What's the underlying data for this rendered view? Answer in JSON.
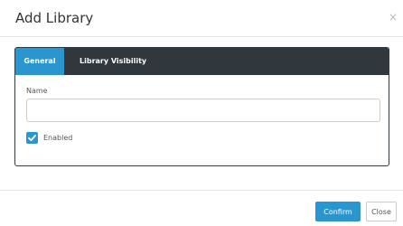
{
  "dialog": {
    "title": "Add Library",
    "close_glyph": "×"
  },
  "tabs": [
    {
      "label": "General",
      "active": true
    },
    {
      "label": "Library Visibility",
      "active": false
    }
  ],
  "form": {
    "name_label": "Name",
    "name_value": "",
    "name_placeholder": "",
    "enabled_label": "Enabled",
    "enabled_checked": true
  },
  "footer": {
    "confirm_label": "Confirm",
    "close_label": "Close"
  },
  "colors": {
    "accent": "#2a96cf",
    "tab_bar": "#30373d"
  },
  "icons": {
    "close": "close-icon",
    "check": "checkmark-icon"
  }
}
